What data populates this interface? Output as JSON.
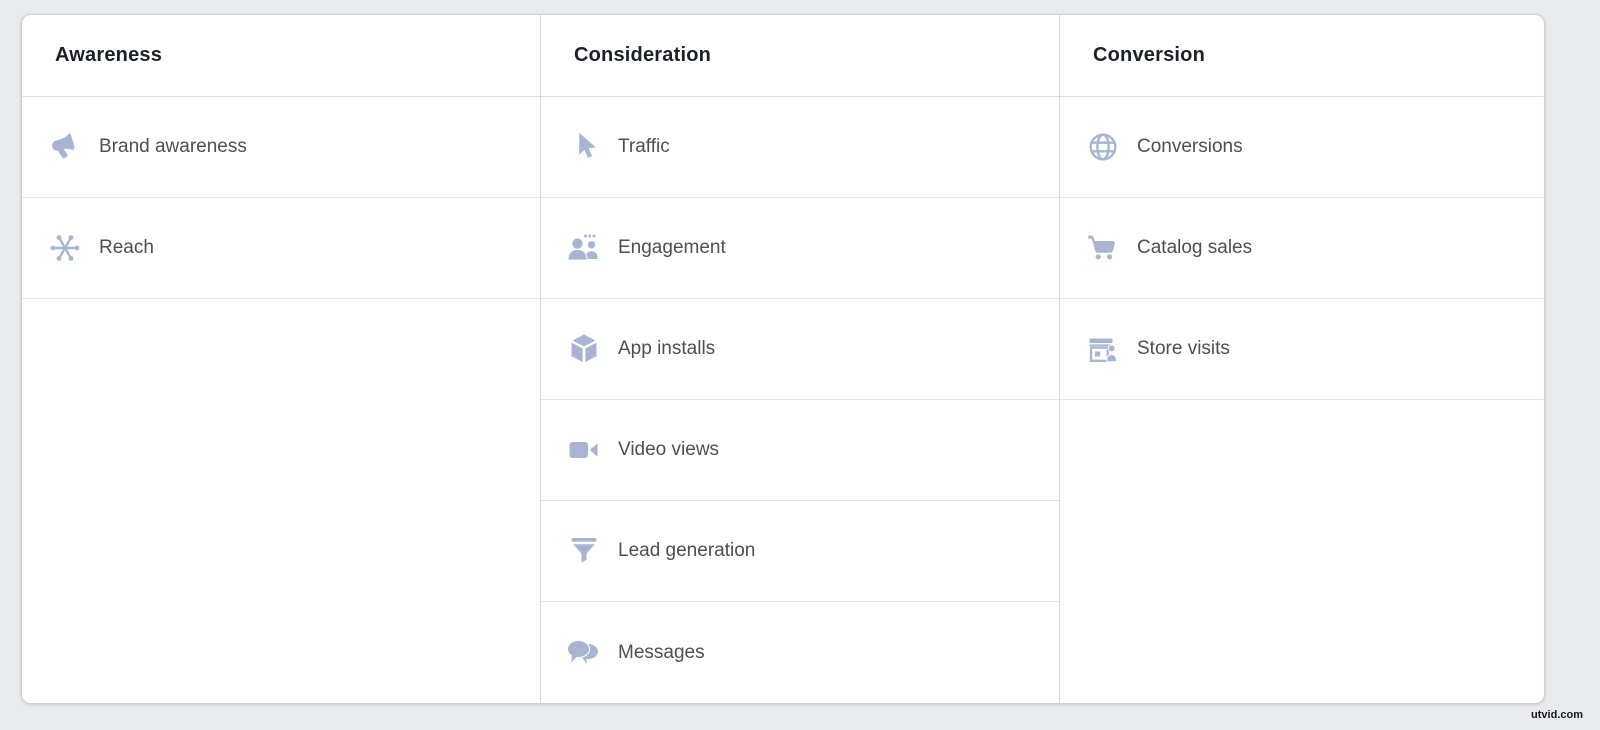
{
  "watermark": "utvid.com",
  "colors": {
    "page_background": "#e9eaed",
    "card_background": "#ffffff",
    "card_border": "#ccd0d5",
    "column_divider": "#d3d6db",
    "row_border": "#e2e4e8",
    "icon": "#a9b4d3",
    "header_text": "#1c2028",
    "item_text": "#4b4f56"
  },
  "columns": [
    {
      "header": "Awareness",
      "items": [
        {
          "label": "Brand awareness",
          "icon": "megaphone-icon"
        },
        {
          "label": "Reach",
          "icon": "reach-spokes-icon"
        }
      ]
    },
    {
      "header": "Consideration",
      "items": [
        {
          "label": "Traffic",
          "icon": "cursor-icon"
        },
        {
          "label": "Engagement",
          "icon": "people-icon"
        },
        {
          "label": "App installs",
          "icon": "cube-icon"
        },
        {
          "label": "Video views",
          "icon": "video-camera-icon"
        },
        {
          "label": "Lead generation",
          "icon": "funnel-icon"
        },
        {
          "label": "Messages",
          "icon": "chat-bubbles-icon"
        }
      ]
    },
    {
      "header": "Conversion",
      "items": [
        {
          "label": "Conversions",
          "icon": "globe-icon"
        },
        {
          "label": "Catalog sales",
          "icon": "shopping-cart-icon"
        },
        {
          "label": "Store visits",
          "icon": "storefront-icon"
        }
      ]
    }
  ]
}
